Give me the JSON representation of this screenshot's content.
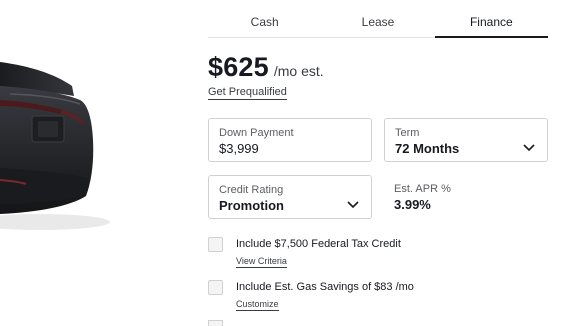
{
  "tabs": [
    "Cash",
    "Lease",
    "Finance"
  ],
  "active_tab": "Finance",
  "price": {
    "amount": "$625",
    "suffix": "/mo est."
  },
  "prequal_link": "Get Prequalified",
  "down_payment": {
    "label": "Down Payment",
    "value": "$3,999"
  },
  "term": {
    "label": "Term",
    "value": "72 Months"
  },
  "credit": {
    "label": "Credit Rating",
    "value": "Promotion"
  },
  "apr": {
    "label": "Est. APR %",
    "value": "3.99%"
  },
  "options": [
    {
      "label": "Include $7,500 Federal Tax Credit",
      "link": "View Criteria",
      "checked": false
    },
    {
      "label": "Include Est. Gas Savings of $83 /mo",
      "link": "Customize",
      "checked": false
    }
  ],
  "icons": {
    "dropdown": "chevron-down-icon"
  },
  "colors": {
    "text": "#171a20",
    "muted": "#5c5e62",
    "border": "#d0d1d2",
    "car_body": "#2b2c30"
  }
}
